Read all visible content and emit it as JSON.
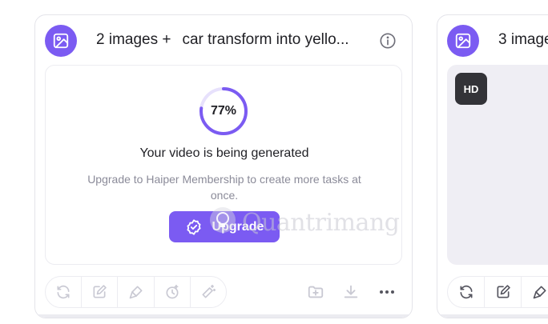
{
  "task_card_1": {
    "count_label": "2 images +",
    "prompt": "car transform into yello...",
    "progress_label": "77%",
    "progress_value": 0.77,
    "status": "Your video is being generated",
    "hint": "Upgrade to Haiper Membership to create more tasks at once.",
    "upgrade_label": "Upgrade"
  },
  "task_card_2": {
    "count_label": "3 image",
    "quality_badge": "HD"
  },
  "watermark": {
    "text": "Quantrimang"
  },
  "colors": {
    "accent": "#7b5bf2",
    "icon_disabled": "#c9c9d3",
    "icon_active": "#55555f"
  }
}
